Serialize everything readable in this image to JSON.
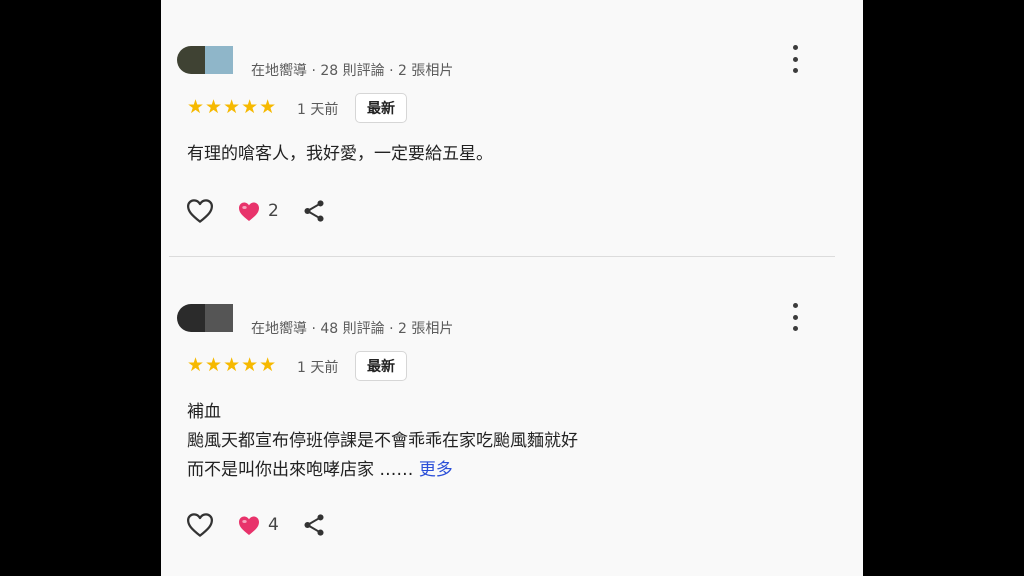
{
  "reviews": [
    {
      "meta": "在地嚮導 · 28 則評論 · 2 張相片",
      "stars": "★★★★★",
      "time": "1 天前",
      "badge": "最新",
      "lines": [
        "有理的嗆客人，我好愛，一定要給五星。"
      ],
      "likes": "2",
      "avatar_colors": [
        "#3f4233",
        "#8fb6c9"
      ]
    },
    {
      "meta": "在地嚮導 · 48 則評論 · 2 張相片",
      "stars": "★★★★★",
      "time": "1 天前",
      "badge": "最新",
      "lines": [
        "補血",
        "颱風天都宣布停班停課是不會乖乖在家吃颱風麵就好",
        "而不是叫你出來咆哮店家 ……"
      ],
      "more": "更多",
      "likes": "4",
      "avatar_colors": [
        "#2b2b2b",
        "#555555"
      ]
    }
  ],
  "colors": {
    "star": "#f6b900",
    "link": "#2b4fd8",
    "heart": "#e8336b"
  },
  "icons": {
    "like": "heart-outline-icon",
    "reaction": "heart-emoji-icon",
    "share": "share-icon",
    "menu": "more-vert-icon"
  }
}
